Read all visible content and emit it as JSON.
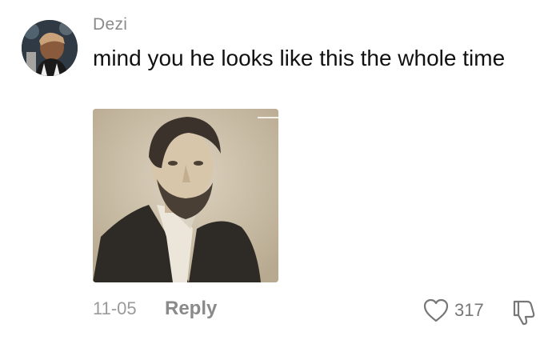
{
  "comment": {
    "username": "Dezi",
    "text": "mind you he looks like this the whole time",
    "date": "11-05",
    "reply_label": "Reply",
    "like_count": "317",
    "avatar_icon": "user-avatar",
    "like_icon": "heart-icon",
    "dislike_icon": "thumbs-down-icon",
    "image": "sepia-portrait-photo"
  },
  "colors": {
    "username": "#8a8a8a",
    "text": "#111111",
    "meta": "#9a9a9a",
    "icon": "#777777"
  }
}
